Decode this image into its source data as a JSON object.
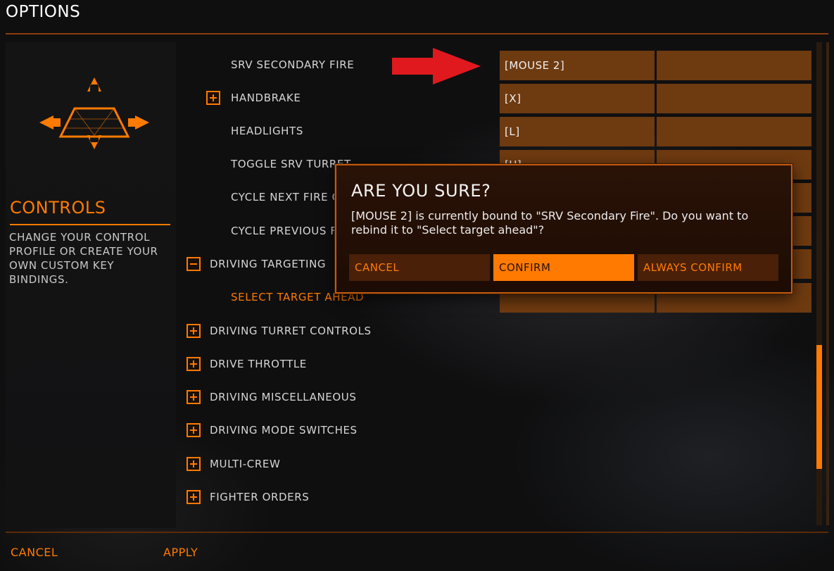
{
  "window": {
    "title": "OPTIONS"
  },
  "left_panel": {
    "section_title": "CONTROLS",
    "description": "CHANGE YOUR CONTROL PROFILE OR CREATE YOUR OWN CUSTOM KEY BINDINGS."
  },
  "list": {
    "rows": [
      {
        "label": "SRV SECONDARY FIRE",
        "binding": "[MOUSE 2]"
      },
      {
        "label": "HANDBRAKE",
        "binding": "[X]"
      },
      {
        "label": "HEADLIGHTS",
        "binding": "[L]"
      },
      {
        "label": "TOGGLE SRV TURRET",
        "binding": "[U]"
      },
      {
        "label": "CYCLE NEXT FIRE GROUP"
      },
      {
        "label": "CYCLE PREVIOUS FIRE GROUP"
      },
      {
        "label": "DRIVING TARGETING"
      },
      {
        "label": "SELECT TARGET AHEAD"
      },
      {
        "label": "DRIVING TURRET CONTROLS"
      },
      {
        "label": "DRIVE THROTTLE"
      },
      {
        "label": "DRIVING MISCELLANEOUS"
      },
      {
        "label": "DRIVING MODE SWITCHES"
      },
      {
        "label": "MULTI-CREW"
      },
      {
        "label": "FIGHTER ORDERS"
      }
    ]
  },
  "dialog": {
    "title": "ARE YOU SURE?",
    "message": "[MOUSE 2] is currently bound to \"SRV Secondary Fire\". Do you want to rebind it to \"Select target ahead\"?",
    "cancel_label": "CANCEL",
    "confirm_label": "CONFIRM",
    "always_confirm_label": "ALWAYS CONFIRM"
  },
  "footer": {
    "cancel_label": "CANCEL",
    "apply_label": "APPLY"
  },
  "colors": {
    "accent": "#ff7a00",
    "binding_bg": "#6e3a10",
    "annotation_arrow": "#e0191e"
  },
  "icons": [
    "arrow-up-icon",
    "arrow-down-icon",
    "arrow-left-icon",
    "arrow-right-icon",
    "ship-icon",
    "plus-icon",
    "minus-icon",
    "red-arrow-icon"
  ]
}
